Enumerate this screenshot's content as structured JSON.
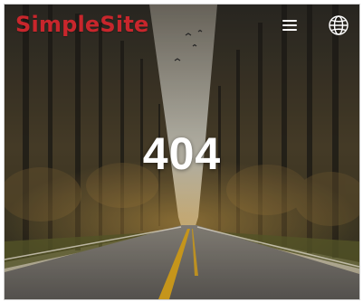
{
  "header": {
    "logo_text": "SimpleSite",
    "menu_icon": "hamburger-menu-icon",
    "language_icon": "globe-icon"
  },
  "main": {
    "error_code": "404"
  },
  "colors": {
    "brand": "#c8262c",
    "heading": "#ffffff"
  }
}
